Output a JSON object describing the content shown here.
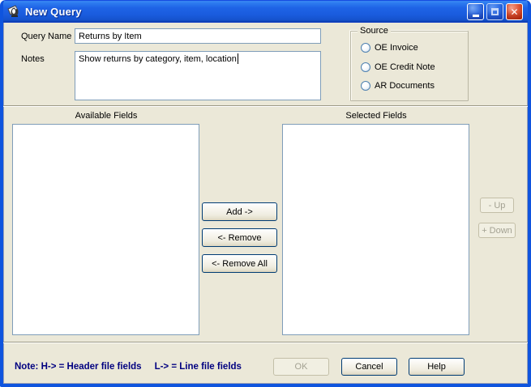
{
  "colors": {
    "titlebar_blue": "#1A5CDE",
    "window_frame_blue": "#0F54DE",
    "dialog_background": "#EBE8D8",
    "field_border": "#7F9DB9",
    "button_border": "#003C74",
    "close_button_red": "#E25C3C",
    "note_text_navy": "#000080"
  },
  "titlebar": {
    "title": "New Query",
    "close_glyph": "✕"
  },
  "form": {
    "query_name_label": "Query Name",
    "query_name_value": "Returns by Item",
    "notes_label": "Notes",
    "notes_value": "Show returns by category, item, location",
    "source": {
      "label": "Source",
      "options": [
        {
          "label": "OE Invoice",
          "selected": false
        },
        {
          "label": "OE Credit Note",
          "selected": false
        },
        {
          "label": "AR Documents",
          "selected": false
        }
      ]
    }
  },
  "fields_section": {
    "available_label": "Available Fields",
    "selected_label": "Selected Fields",
    "available_items": [],
    "selected_items": [],
    "add_button": "Add ->",
    "remove_button": "<- Remove",
    "remove_all_button": "<- Remove All",
    "up_button": "- Up",
    "down_button": "+ Down"
  },
  "footer": {
    "note_part1": "Note: H-> = Header file fields",
    "note_part2": "L-> = Line file fields",
    "ok_button": "OK",
    "cancel_button": "Cancel",
    "help_button": "Help"
  }
}
